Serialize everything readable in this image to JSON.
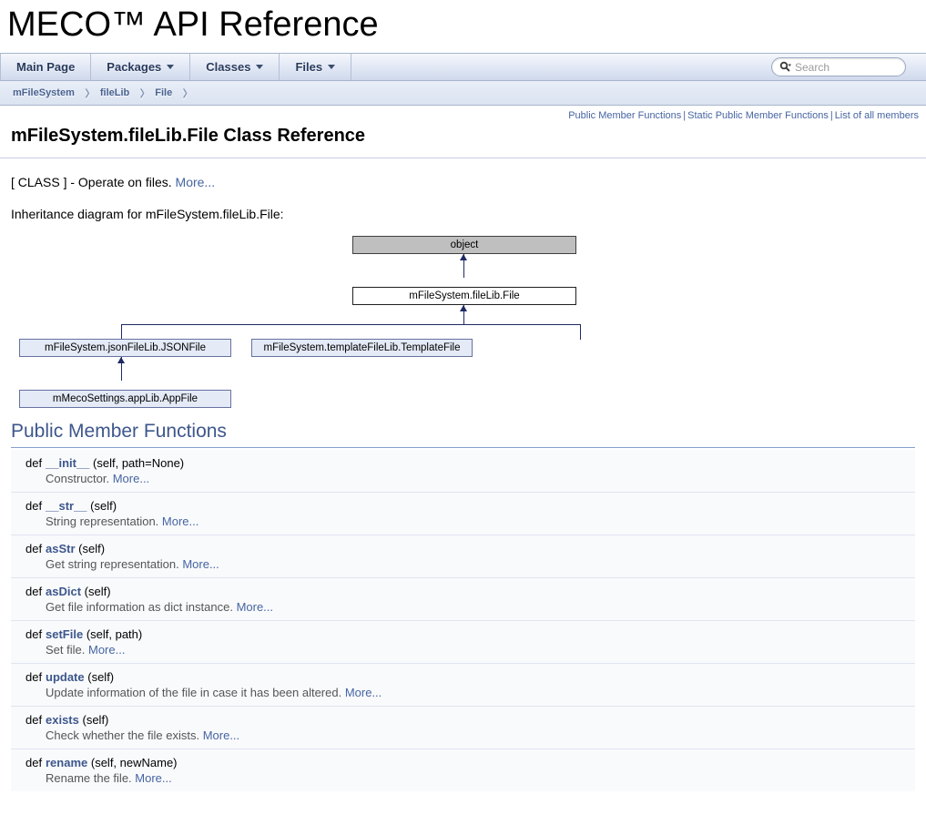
{
  "project": {
    "name": "MECO™ API Reference"
  },
  "nav": {
    "tabs": [
      {
        "label": "Main Page",
        "has_caret": false
      },
      {
        "label": "Packages",
        "has_caret": true
      },
      {
        "label": "Classes",
        "has_caret": true
      },
      {
        "label": "Files",
        "has_caret": true
      }
    ],
    "search": {
      "placeholder": "Search",
      "value": "",
      "icon": "search-icon"
    },
    "breadcrumbs": [
      {
        "label": "mFileSystem"
      },
      {
        "label": "fileLib"
      },
      {
        "label": "File"
      }
    ]
  },
  "summary_links": [
    {
      "label": "Public Member Functions"
    },
    {
      "label": "Static Public Member Functions"
    },
    {
      "label": "List of all members"
    }
  ],
  "page": {
    "title": "mFileSystem.fileLib.File Class Reference",
    "brief_prefix": "[ CLASS ] - Operate on files.",
    "brief_more": "More...",
    "inheritance_caption": "Inheritance diagram for mFileSystem.fileLib.File:"
  },
  "inheritance": {
    "nodes": [
      {
        "id": "object",
        "label": "object",
        "kind": "root"
      },
      {
        "id": "file",
        "label": "mFileSystem.fileLib.File",
        "kind": "self"
      },
      {
        "id": "jsonfile",
        "label": "mFileSystem.jsonFileLib.JSONFile",
        "kind": "derived"
      },
      {
        "id": "templatefile",
        "label": "mFileSystem.templateFileLib.TemplateFile",
        "kind": "derived"
      },
      {
        "id": "appfile",
        "label": "mMecoSettings.appLib.AppFile",
        "kind": "derived"
      }
    ],
    "edges": [
      {
        "from": "file",
        "to": "object"
      },
      {
        "from": "jsonfile",
        "to": "file"
      },
      {
        "from": "templatefile",
        "to": "file"
      },
      {
        "from": "appfile",
        "to": "jsonfile"
      }
    ],
    "colors": {
      "root_fill": "#bfbfbf",
      "self_fill": "#ffffff",
      "derived_fill": "#e4eaf6",
      "line": "#1f2a63"
    }
  },
  "sections": [
    {
      "heading": "Public Member Functions",
      "members": [
        {
          "kind": "def",
          "name": "__init__",
          "args": "(self, path=None)",
          "description": "Constructor.",
          "more": "More..."
        },
        {
          "kind": "def",
          "name": "__str__",
          "args": "(self)",
          "description": "String representation.",
          "more": "More..."
        },
        {
          "kind": "def",
          "name": "asStr",
          "args": "(self)",
          "description": "Get string representation.",
          "more": "More..."
        },
        {
          "kind": "def",
          "name": "asDict",
          "args": "(self)",
          "description": "Get file information as dict instance.",
          "more": "More..."
        },
        {
          "kind": "def",
          "name": "setFile",
          "args": "(self, path)",
          "description": "Set file.",
          "more": "More..."
        },
        {
          "kind": "def",
          "name": "update",
          "args": "(self)",
          "description": "Update information of the file in case it has been altered.",
          "more": "More..."
        },
        {
          "kind": "def",
          "name": "exists",
          "args": "(self)",
          "description": "Check whether the file exists.",
          "more": "More..."
        },
        {
          "kind": "def",
          "name": "rename",
          "args": "(self, newName)",
          "description": "Rename the file.",
          "more": "More..."
        }
      ]
    }
  ],
  "theme": {
    "accent": "#3d578c",
    "link": "#4665a2",
    "nav_border": "#a7b5cc",
    "row_bg": "#f9fafc",
    "desc_text": "#555555"
  }
}
